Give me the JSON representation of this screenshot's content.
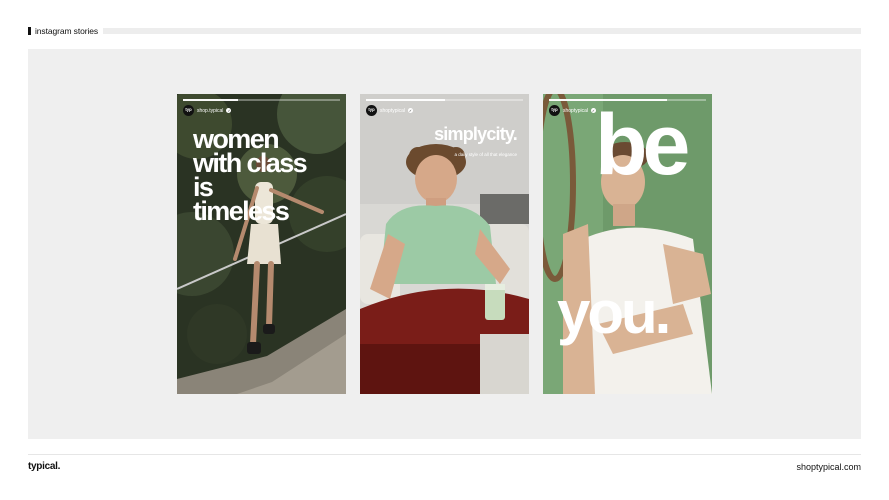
{
  "header": {
    "section_label": "instagram stories"
  },
  "stories": [
    {
      "handle": "shop.typical",
      "avatar_label": "typ",
      "progress": 0.35,
      "headline_lines": [
        "women",
        "with class",
        "is",
        "timeless"
      ]
    },
    {
      "handle": "shoptypical",
      "avatar_label": "typ",
      "progress": 0.5,
      "headline": "simplycity.",
      "tagline": "a daily style of all that elegance"
    },
    {
      "handle": "shoptypical",
      "avatar_label": "typ",
      "progress": 0.75,
      "word_top": "be",
      "word_bottom": "you."
    }
  ],
  "footer": {
    "brand": "typical.",
    "url": "shoptypical.com"
  },
  "colors": {
    "panel": "#efefef",
    "rule": "#ededed",
    "story3_bg": "#6e9a6a",
    "polo": "#9ccaa5",
    "table": "#7a1d18"
  },
  "icons": [
    "verified-badge-icon"
  ]
}
